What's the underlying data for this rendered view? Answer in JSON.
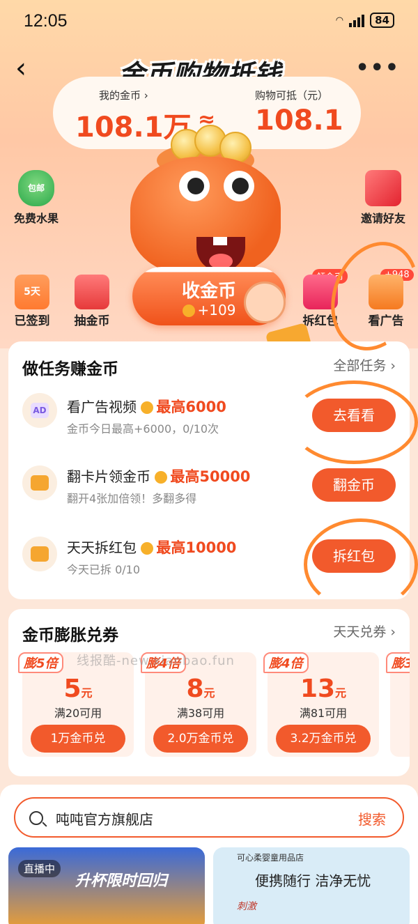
{
  "status_bar": {
    "time": "12:05",
    "battery": "84"
  },
  "header": {
    "title": "金币购物抵钱",
    "back_icon": "chevron-left-icon",
    "more_icon": "more-dots-icon"
  },
  "coin_summary": {
    "my_coins_label": "我的金币",
    "my_coins_value": "108.1万",
    "approx": "≈",
    "deduct_label": "购物可抵（元）",
    "deduct_value": "108.1"
  },
  "side": {
    "free_fruit_badge": "包邮",
    "free_fruit_label": "免费水果",
    "invite_label": "邀请好友"
  },
  "quick": [
    {
      "icon_text": "5天",
      "label": "已签到"
    },
    {
      "icon_text": "",
      "label": "抽金币"
    },
    {
      "tag": "领金币",
      "label": "拆红包"
    },
    {
      "tag": "+948",
      "label": "看广告"
    }
  ],
  "collect_button": {
    "label": "收金币",
    "amount": "+109"
  },
  "tasks": {
    "title": "做任务赚金币",
    "more": "全部任务",
    "items": [
      {
        "icon": "ad-icon",
        "icon_text": "AD",
        "title": "看广告视频",
        "max": "最高6000",
        "sub": "金币今日最高+6000，0/10次",
        "button": "去看看"
      },
      {
        "icon": "cards-icon",
        "title": "翻卡片领金币",
        "max": "最高50000",
        "sub": "翻开4张加倍领！多翻多得",
        "button": "翻金币"
      },
      {
        "icon": "red-packet-icon",
        "title": "天天拆红包",
        "max": "最高10000",
        "sub": "今天已拆 0/10",
        "button": "拆红包"
      }
    ]
  },
  "vouchers": {
    "title": "金币膨胀兑券",
    "more": "天天兑券",
    "items": [
      {
        "badge": "膨5倍",
        "amount": "5",
        "unit": "元",
        "cond": "满20可用",
        "exchange": "1万金币兑"
      },
      {
        "badge": "膨4倍",
        "amount": "8",
        "unit": "元",
        "cond": "满38可用",
        "exchange": "2.0万金币兑"
      },
      {
        "badge": "膨4倍",
        "amount": "13",
        "unit": "元",
        "cond": "满81可用",
        "exchange": "3.2万金币兑"
      }
    ],
    "partial_badge": "膨3"
  },
  "watermark": "线报酷-new.xianbao.fun",
  "search": {
    "query": "吨吨官方旗舰店",
    "button": "搜索"
  },
  "feed": {
    "left_live": "直播中",
    "left_banner": "升杯限时回归",
    "right_store": "可心柔婴童用品店",
    "right_slogan": "便携随行 洁净无忧",
    "right_tag": "刺激"
  },
  "colors": {
    "accent": "#f25a2c",
    "price": "#f04a1f"
  }
}
